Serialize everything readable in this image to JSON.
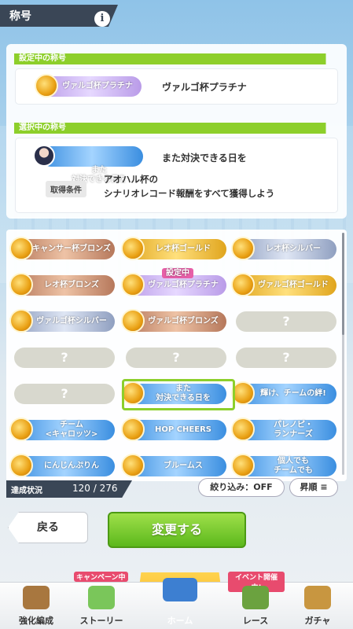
{
  "header": {
    "title": "称号",
    "info_icon": "i"
  },
  "current": {
    "section_label": "設定中の称号",
    "badge": "ヴァルゴ杯プラチナ",
    "name": "ヴァルゴ杯プラチナ"
  },
  "selected": {
    "section_label": "選択中の称号",
    "badge": "また\n対決できる日を",
    "name": "また対決できる日を",
    "condition_label": "取得条件",
    "condition_line1": "アオハル杯の",
    "condition_line2": "シナリオレコード報酬をすべて獲得しよう"
  },
  "grid": [
    [
      {
        "label": "キャンサー杯ブロンズ",
        "style": "bronze"
      },
      {
        "label": "レオ杯ゴールド",
        "style": "gold"
      },
      {
        "label": "レオ杯シルバー",
        "style": "silver"
      }
    ],
    [
      {
        "label": "レオ杯ブロンズ",
        "style": "bronze"
      },
      {
        "label": "ヴァルゴ杯プラチナ",
        "style": "plat",
        "tag": "設定中"
      },
      {
        "label": "ヴァルゴ杯ゴールド",
        "style": "gold"
      }
    ],
    [
      {
        "label": "ヴァルゴ杯シルバー",
        "style": "silver"
      },
      {
        "label": "ヴァルゴ杯ブロンズ",
        "style": "bronze"
      },
      {
        "label": "?",
        "style": "unk"
      }
    ],
    [
      {
        "label": "?",
        "style": "unk"
      },
      {
        "label": "?",
        "style": "unk"
      },
      {
        "label": "?",
        "style": "unk"
      }
    ],
    [
      {
        "label": "?",
        "style": "unk"
      },
      {
        "label": "また\n対決できる日を",
        "style": "blue",
        "selected": true
      },
      {
        "label": "輝け、チームの絆!",
        "style": "blue"
      }
    ],
    [
      {
        "label": "チーム\n<キャロッツ>",
        "style": "blue"
      },
      {
        "label": "HOP CHEERS",
        "style": "blue"
      },
      {
        "label": "パレノピ・\nランナーズ",
        "style": "blue"
      }
    ],
    [
      {
        "label": "にんじんぷりん",
        "style": "blue"
      },
      {
        "label": "ブルームス",
        "style": "blue"
      },
      {
        "label": "個人でも\nチームでも",
        "style": "blue"
      }
    ]
  ],
  "status": {
    "label": "達成状況",
    "value": "120 / 276"
  },
  "filter_button": "絞り込み：OFF",
  "sort_button": "昇順",
  "back_button": "戻る",
  "change_button": "変更する",
  "nav": [
    {
      "label": "強化編成",
      "icon": "horse-girl-icon"
    },
    {
      "label": "ストーリー",
      "icon": "book-icon",
      "badge": "キャンペーン中"
    },
    {
      "label": "ホーム",
      "icon": "school-building-icon"
    },
    {
      "label": "レース",
      "icon": "race-flag-icon",
      "badge": "イベント開催中!"
    },
    {
      "label": "ガチャ",
      "icon": "gacha-icon"
    }
  ],
  "colors": {
    "accent_green": "#8dcf2b",
    "header_dark": "#3a4656",
    "home_gold": "#f2a516"
  }
}
